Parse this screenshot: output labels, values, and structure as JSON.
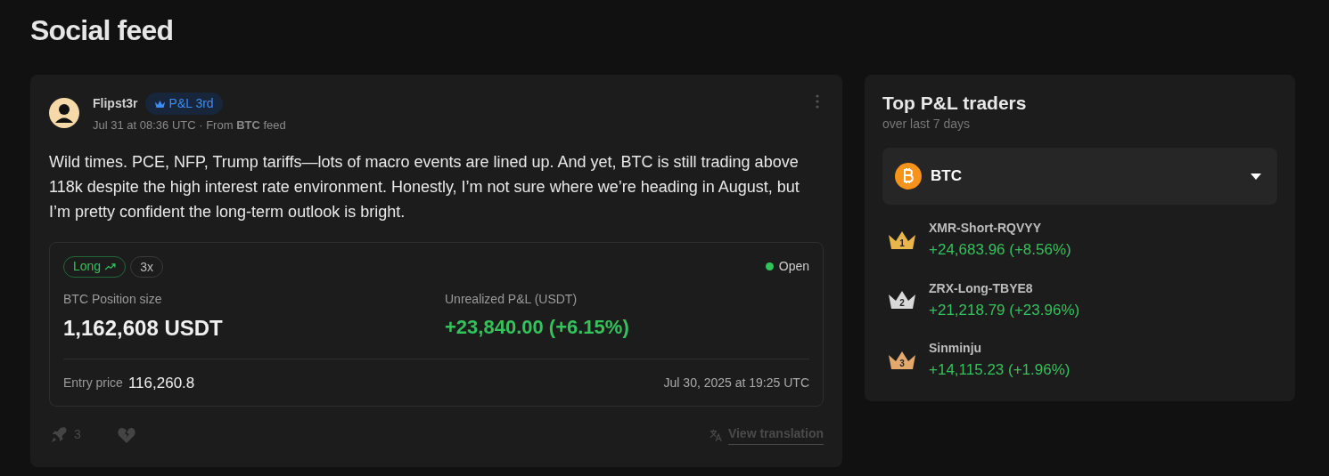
{
  "page_title": "Social feed",
  "post": {
    "author": "Flipst3r",
    "badge": "P&L 3rd",
    "meta": "Jul 31 at 08:36 UTC · From **BTC** feed",
    "body": "Wild times. PCE, NFP, Trump tariffs—lots of macro events are lined up. And yet, BTC is still trading above 118k despite the high interest rate environment. Honestly, I’m not sure where we’re heading in August, but I’m pretty confident the long-term outlook is bright.",
    "position": {
      "side": "Long",
      "leverage": "3x",
      "status": "Open",
      "size_label": "BTC Position size",
      "size_value": "1,162,608 USDT",
      "pnl_label": "Unrealized P&L (USDT)",
      "pnl_value": "+23,840.00 (+6.15%)",
      "entry_label": "Entry price",
      "entry_value": "116,260.8",
      "opened": "Jul 30, 2025 at 19:25 UTC"
    },
    "reactions": {
      "rockets": "3"
    },
    "translate": "View translation"
  },
  "leaderboard": {
    "title": "Top P&L traders",
    "subtitle": "over last 7 days",
    "asset": "BTC",
    "traders": [
      {
        "rank": "1",
        "color": "#e8b64a",
        "name": "XMR-Short-RQVYY",
        "pnl": "+24,683.96 (+8.56%)"
      },
      {
        "rank": "2",
        "color": "#d9d9d9",
        "name": "ZRX-Long-TBYE8",
        "pnl": "+21,218.79 (+23.96%)"
      },
      {
        "rank": "3",
        "color": "#e3a86b",
        "name": "Sinminju",
        "pnl": "+14,115.23 (+1.96%)"
      }
    ]
  }
}
